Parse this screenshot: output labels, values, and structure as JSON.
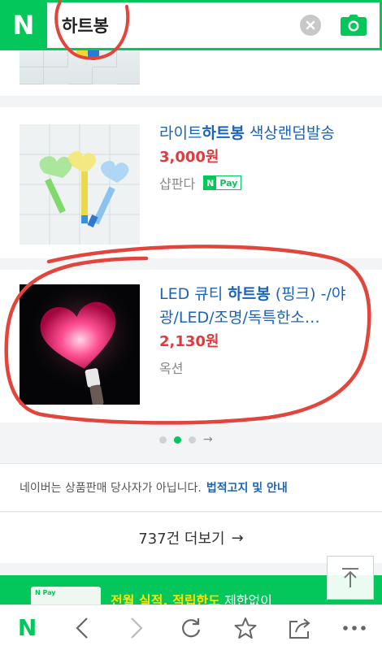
{
  "search": {
    "query": "하트봉"
  },
  "header": {
    "logo": "N"
  },
  "products": [
    {
      "title_prefix": "라이트",
      "title_highlight": "하트봉",
      "title_suffix": " 색상랜덤발송",
      "price": "3,000원",
      "seller": "샵판다",
      "npay": {
        "n": "N",
        "label": "Pay"
      }
    },
    {
      "title_prefix": "LED 큐티 ",
      "title_highlight": "하트봉",
      "title_suffix": " (핑크) -/야광/LED/조명/독특한소…",
      "price": "2,130원",
      "seller": "옥션"
    }
  ],
  "pagination": {
    "next_arrow": "→"
  },
  "notice": {
    "text": "네이버는 상품판매 당사자가 아닙니다.",
    "link": "법적고지 및 안내"
  },
  "more": {
    "label": "737건 더보기",
    "arrow": "→"
  },
  "banner": {
    "highlight": "전월 실적, 적립한도",
    "text": " 제한없이",
    "card_label": "N Pay"
  },
  "toolbar": {
    "logo": "N"
  },
  "colors": {
    "brand_green": "#03c75a",
    "link_blue": "#1a63b8",
    "price_red": "#e4393c",
    "annotation_red": "#e2453c"
  },
  "icons": [
    "clear-icon",
    "camera-icon",
    "back-icon",
    "forward-icon",
    "refresh-icon",
    "star-icon",
    "share-icon",
    "more-icon",
    "arrow-up-icon"
  ]
}
